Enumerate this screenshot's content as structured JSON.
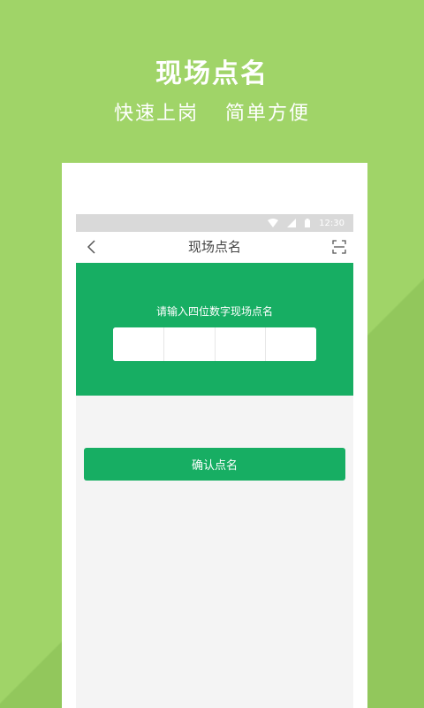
{
  "promo": {
    "title": "现场点名",
    "subtitle": "快速上岗  简单方便"
  },
  "status_bar": {
    "time": "12:30",
    "icons": [
      "wifi-icon",
      "signal-icon",
      "battery-icon"
    ]
  },
  "nav": {
    "title": "现场点名",
    "back_icon": "chevron-left-icon",
    "scan_icon": "scan-icon"
  },
  "roll_call": {
    "prompt": "请输入四位数字现场点名",
    "code_digits": [
      "",
      "",
      "",
      ""
    ]
  },
  "actions": {
    "confirm_label": "确认点名"
  },
  "colors": {
    "background": "#a0d468",
    "brand_green": "#17ae63",
    "screen_bg": "#f4f4f4",
    "status_bar": "#d9d9d9"
  }
}
